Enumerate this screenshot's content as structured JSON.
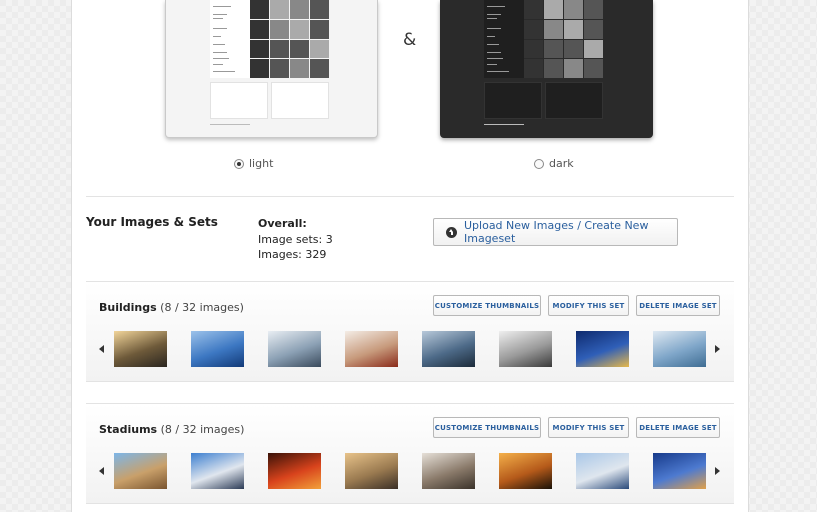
{
  "themes": {
    "separator": "&",
    "light_label": "light",
    "dark_label": "dark",
    "selected": "light"
  },
  "summary": {
    "title": "Your Images & Sets",
    "overall_label": "Overall:",
    "image_sets": "Image sets: 3",
    "images": "Images: 329",
    "upload_label": "Upload New Images / Create New Imageset"
  },
  "imagesets": [
    {
      "name": "Buildings",
      "count": "(8 / 32 images)",
      "customize_label": "CUSTOMIZE THUMBNAILS",
      "modify_label": "MODIFY THIS SET",
      "delete_label": "DELETE IMAGE SET",
      "thumbnails": [
        {
          "desc": "skyscraper-sunburst",
          "colors": [
            "#f2d59a",
            "#6e5a3a",
            "#2b2620"
          ]
        },
        {
          "desc": "glass-tower-sky",
          "colors": [
            "#9cc2ea",
            "#3c77c2",
            "#123a78"
          ]
        },
        {
          "desc": "city-skyline-water",
          "colors": [
            "#e9eef3",
            "#8ba0b4",
            "#3a4a5c"
          ]
        },
        {
          "desc": "modern-interior",
          "colors": [
            "#f4ede6",
            "#c79a7c",
            "#8a2a1a"
          ]
        },
        {
          "desc": "glass-facade",
          "colors": [
            "#b8c9da",
            "#4d6a88",
            "#1c2b3a"
          ]
        },
        {
          "desc": "conference-room",
          "colors": [
            "#efefef",
            "#9a9a9a",
            "#3a3a3a"
          ]
        },
        {
          "desc": "tower-bridge-night",
          "colors": [
            "#0e2a6e",
            "#2f5fb8",
            "#e6b84a"
          ]
        },
        {
          "desc": "office-interior",
          "colors": [
            "#dfe9f2",
            "#7fa6c9",
            "#3f6d93"
          ]
        }
      ]
    },
    {
      "name": "Stadiums",
      "count": "(8 / 32 images)",
      "customize_label": "CUSTOMIZE THUMBNAILS",
      "modify_label": "MODIFY THIS SET",
      "delete_label": "DELETE IMAGE SET",
      "thumbnails": [
        {
          "desc": "colosseum-ruins",
          "colors": [
            "#7db6e8",
            "#c9a06a",
            "#7a5530"
          ]
        },
        {
          "desc": "olympic-stadium",
          "colors": [
            "#3c7fd0",
            "#e0e6ee",
            "#2b3a55"
          ]
        },
        {
          "desc": "stadium-red-lights",
          "colors": [
            "#3a1208",
            "#d8431c",
            "#f2a13a"
          ]
        },
        {
          "desc": "city-stadium-dusk",
          "colors": [
            "#e8c38a",
            "#9a7a50",
            "#3a2f26"
          ]
        },
        {
          "desc": "birds-nest-stadium",
          "colors": [
            "#e6e0d8",
            "#8a7a6a",
            "#3a322a"
          ]
        },
        {
          "desc": "stadium-silhouette-sunset",
          "colors": [
            "#f4b04a",
            "#b55a1a",
            "#1a1208"
          ]
        },
        {
          "desc": "stadium-dome",
          "colors": [
            "#a9c7e8",
            "#dfe6ee",
            "#2a4a7a"
          ]
        },
        {
          "desc": "colosseum-night",
          "colors": [
            "#173a8a",
            "#4d7ad0",
            "#e0a04a"
          ]
        }
      ]
    }
  ]
}
